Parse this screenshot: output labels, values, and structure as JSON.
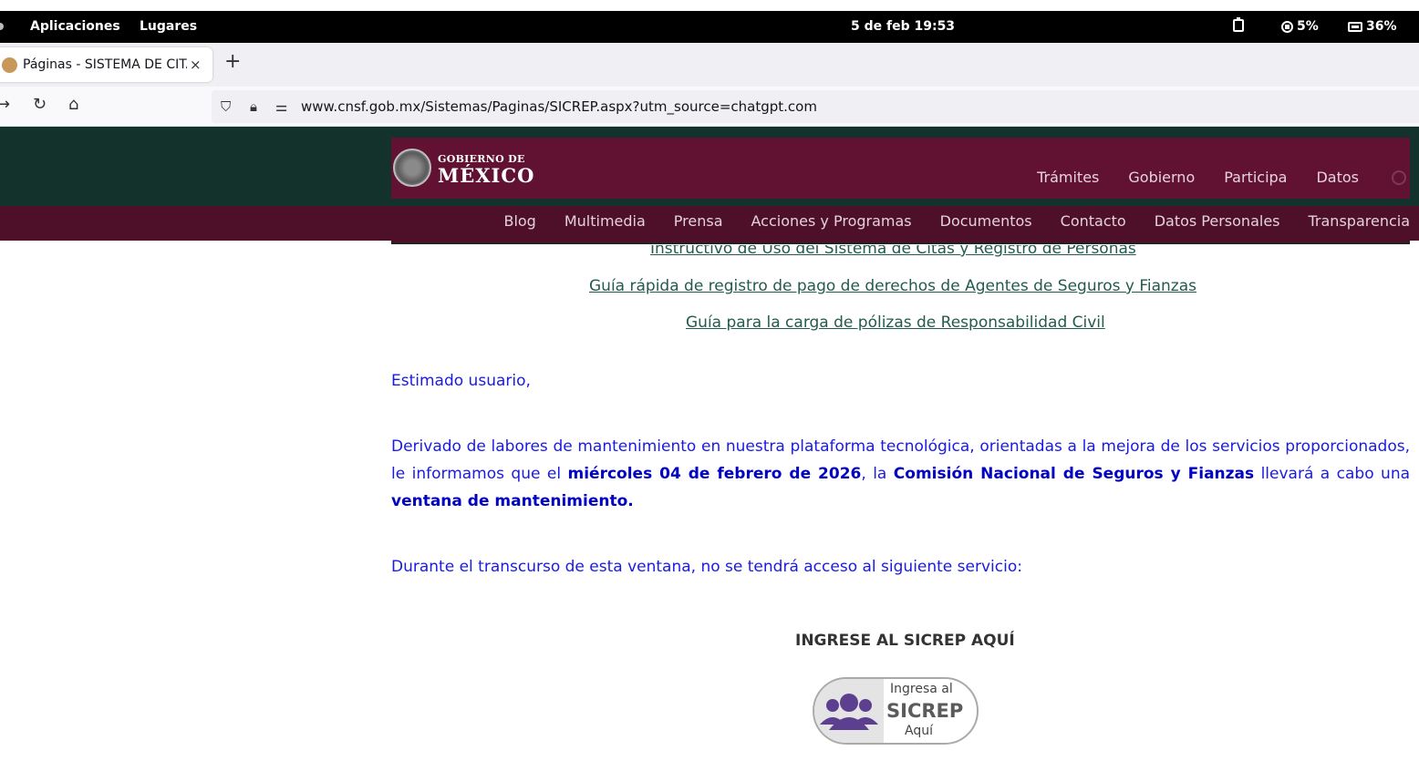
{
  "system_bar": {
    "menu_apps": "Aplicaciones",
    "menu_places": "Lugares",
    "clock": "5 de feb  19:53",
    "cpu": "5%",
    "battery": "36%"
  },
  "browser": {
    "tab_title": "Páginas - SISTEMA DE CITAS",
    "tab_close": "×",
    "new_tab": "+",
    "url": "www.cnsf.gob.mx/Sistemas/Paginas/SICREP.aspx?utm_source=chatgpt.com"
  },
  "site_header": {
    "logo_top": "GOBIERNO DE",
    "logo_main": "MÉXICO",
    "main_nav": [
      "Trámites",
      "Gobierno",
      "Participa",
      "Datos"
    ],
    "sub_nav": [
      "Blog",
      "Multimedia",
      "Prensa",
      "Acciones y Programas",
      "Documentos",
      "Contacto",
      "Datos Personales",
      "Transparencia"
    ]
  },
  "content": {
    "links": [
      "Instructivo de Uso del Sistema de Citas y Registro de Personas",
      "Guía rápida de registro de pago de derechos de Agentes de Seguros y Fianzas",
      "Guía para la carga de pólizas de Responsabilidad Civil"
    ],
    "greeting": "Estimado usuario,",
    "notice_part1": "Derivado de labores de mantenimiento en nuestra plataforma tecnológica, orientadas a la mejora de los servicios proporcionados, le informamos que el ",
    "notice_bold_date": "miércoles 04 de febrero de 2026",
    "notice_part2": ", la ",
    "notice_bold_org": "Comisión Nacional de Seguros y Fianzas",
    "notice_part3": " llevará a cabo una ",
    "notice_bold_window": "ventana de mantenimiento.",
    "service_notice": "Durante el transcurso de esta ventana, no se tendrá acceso al siguiente servicio:",
    "ingrese_heading": "INGRESE AL SICREP AQUÍ",
    "sicrep_button": {
      "line1": "Ingresa al",
      "line2": "SICREP",
      "line3": "Aquí"
    }
  },
  "colors": {
    "header_green": "#13322b",
    "header_maroon": "#611232",
    "link_green": "#235b4e",
    "notice_blue": "#1a1ae6"
  }
}
